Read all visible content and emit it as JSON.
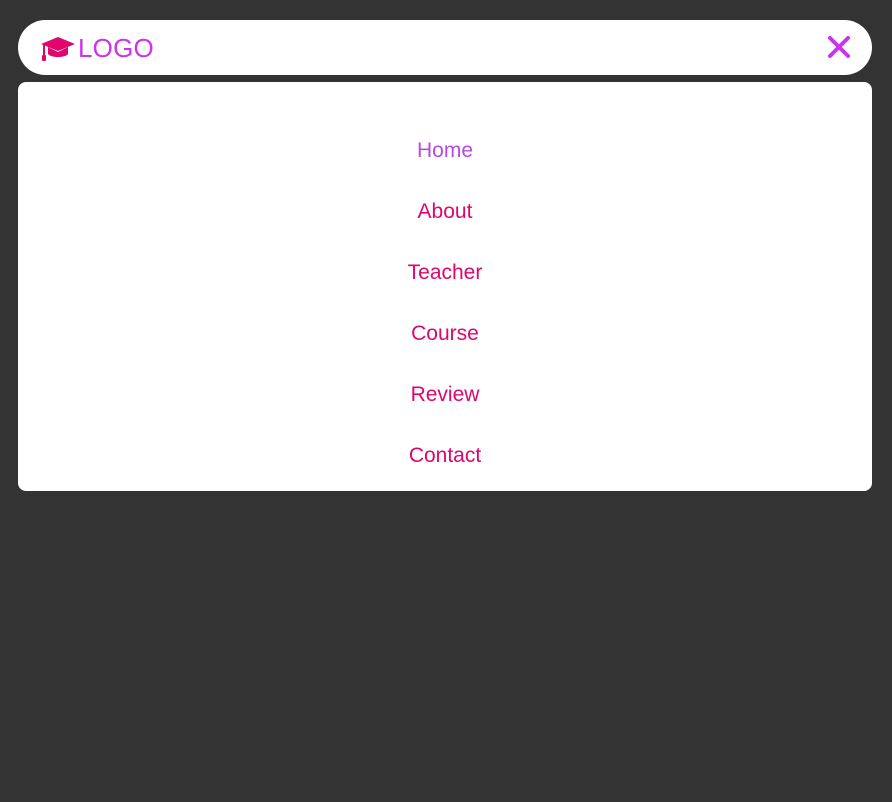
{
  "colors": {
    "background": "#333333",
    "surface": "#ffffff",
    "accent_pink": "#e0066b",
    "accent_purple": "#cc33ee",
    "active_link": "#b94ae0"
  },
  "header": {
    "logo_icon": "graduation-cap-icon",
    "logo_text": "LOGO",
    "close_icon": "close-icon"
  },
  "menu": {
    "items": [
      {
        "label": "Home",
        "active": true
      },
      {
        "label": "About",
        "active": false
      },
      {
        "label": "Teacher",
        "active": false
      },
      {
        "label": "Course",
        "active": false
      },
      {
        "label": "Review",
        "active": false
      },
      {
        "label": "Contact",
        "active": false
      }
    ]
  }
}
